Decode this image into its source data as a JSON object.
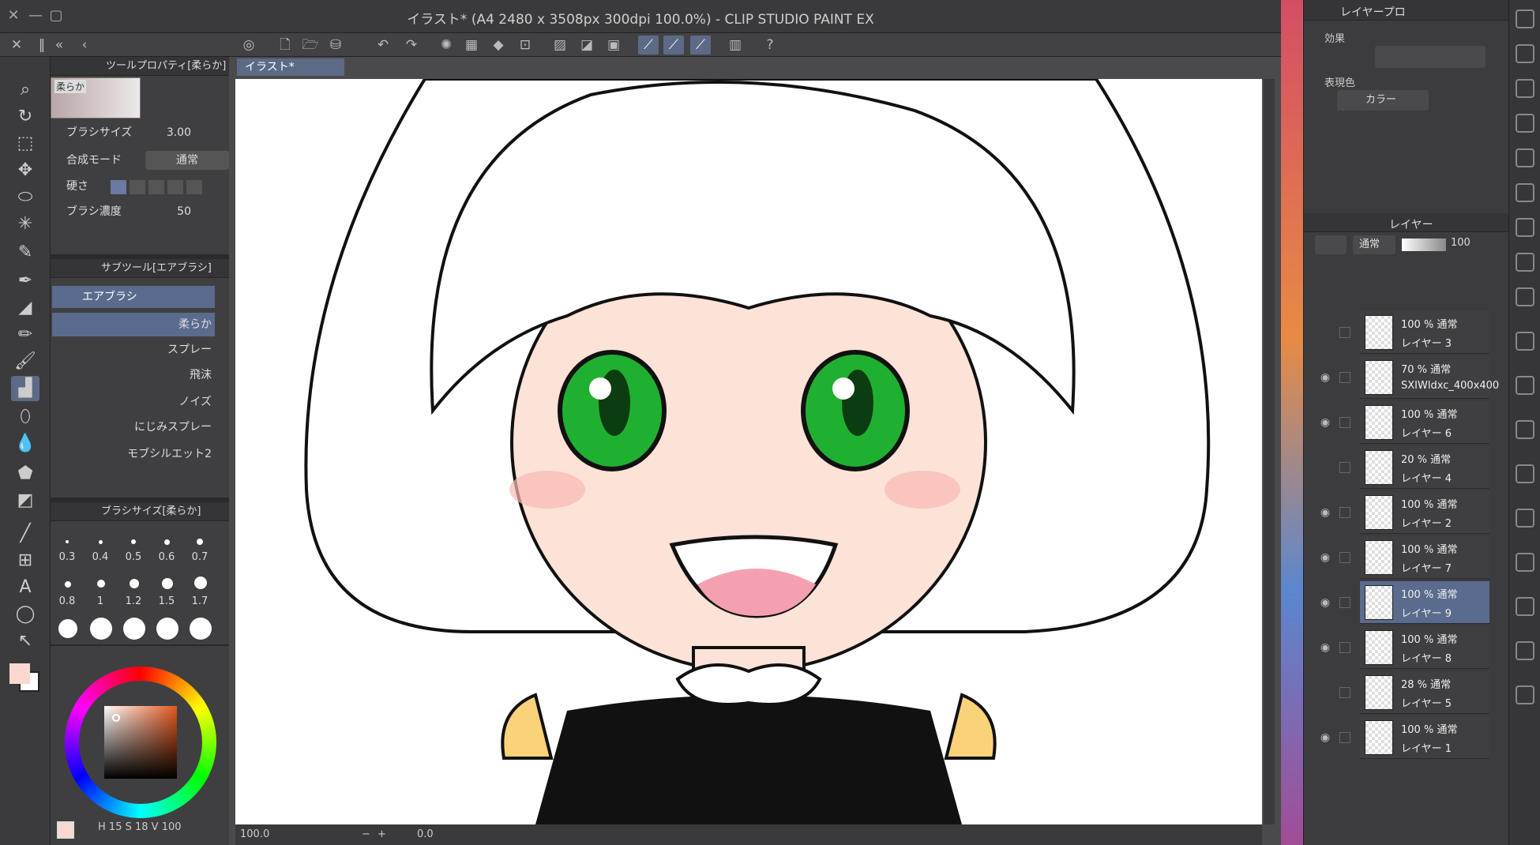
{
  "window": {
    "title": "イラスト* (A4 2480 x 3508px 300dpi 100.0%) - CLIP STUDIO PAINT EX"
  },
  "canvas_tab": "イラスト*",
  "tool_property": {
    "header": "ツールプロパティ[柔らか]",
    "preview_label": "柔らか",
    "brush_size_label": "ブラシサイズ",
    "brush_size_value": "3.00",
    "blend_mode_label": "合成モード",
    "blend_mode_value": "通常",
    "hardness_label": "硬さ",
    "density_label": "ブラシ濃度",
    "density_value": "50"
  },
  "subtool": {
    "header": "サブツール[エアブラシ]",
    "group": "エアブラシ",
    "items": [
      "柔らか",
      "スプレー",
      "飛沫",
      "ノイズ",
      "にじみスプレー",
      "モブシルエット2"
    ]
  },
  "brush_size_panel": {
    "header": "ブラシサイズ[柔らか]",
    "sizes": [
      "0.3",
      "0.4",
      "0.5",
      "0.6",
      "0.7",
      "0.8",
      "1",
      "1.2",
      "1.5",
      "1.7"
    ]
  },
  "color_info": {
    "h": "15",
    "s": "18",
    "v": "100"
  },
  "colors": {
    "main": "#fbd8cf",
    "sub": "#ffffff",
    "accent": "#5c6a86",
    "selected_layer": "#5a6b8e"
  },
  "statusbar": {
    "zoom": "100.0",
    "rotation": "0.0"
  },
  "layer_property": {
    "header": "レイヤープロ",
    "effect_label": "効果",
    "expression_label": "表現色",
    "expression_value": "カラー"
  },
  "layer_panel": {
    "header": "レイヤー",
    "blend_mode": "通常",
    "opacity": "100",
    "layers": [
      {
        "pct": "100 %",
        "mode": "通常",
        "name": "レイヤー 3",
        "visible": false,
        "selected": false
      },
      {
        "pct": "70 %",
        "mode": "通常",
        "name": "SXIWldxc_400x400",
        "visible": true,
        "selected": false
      },
      {
        "pct": "100 %",
        "mode": "通常",
        "name": "レイヤー 6",
        "visible": true,
        "selected": false
      },
      {
        "pct": "20 %",
        "mode": "通常",
        "name": "レイヤー 4",
        "visible": false,
        "selected": false
      },
      {
        "pct": "100 %",
        "mode": "通常",
        "name": "レイヤー 2",
        "visible": true,
        "selected": false
      },
      {
        "pct": "100 %",
        "mode": "通常",
        "name": "レイヤー 7",
        "visible": true,
        "selected": false
      },
      {
        "pct": "100 %",
        "mode": "通常",
        "name": "レイヤー 9",
        "visible": true,
        "selected": true
      },
      {
        "pct": "100 %",
        "mode": "通常",
        "name": "レイヤー 8",
        "visible": true,
        "selected": false
      },
      {
        "pct": "28 %",
        "mode": "通常",
        "name": "レイヤー 5",
        "visible": false,
        "selected": false
      },
      {
        "pct": "100 %",
        "mode": "通常",
        "name": "レイヤー 1",
        "visible": true,
        "selected": false
      }
    ]
  }
}
